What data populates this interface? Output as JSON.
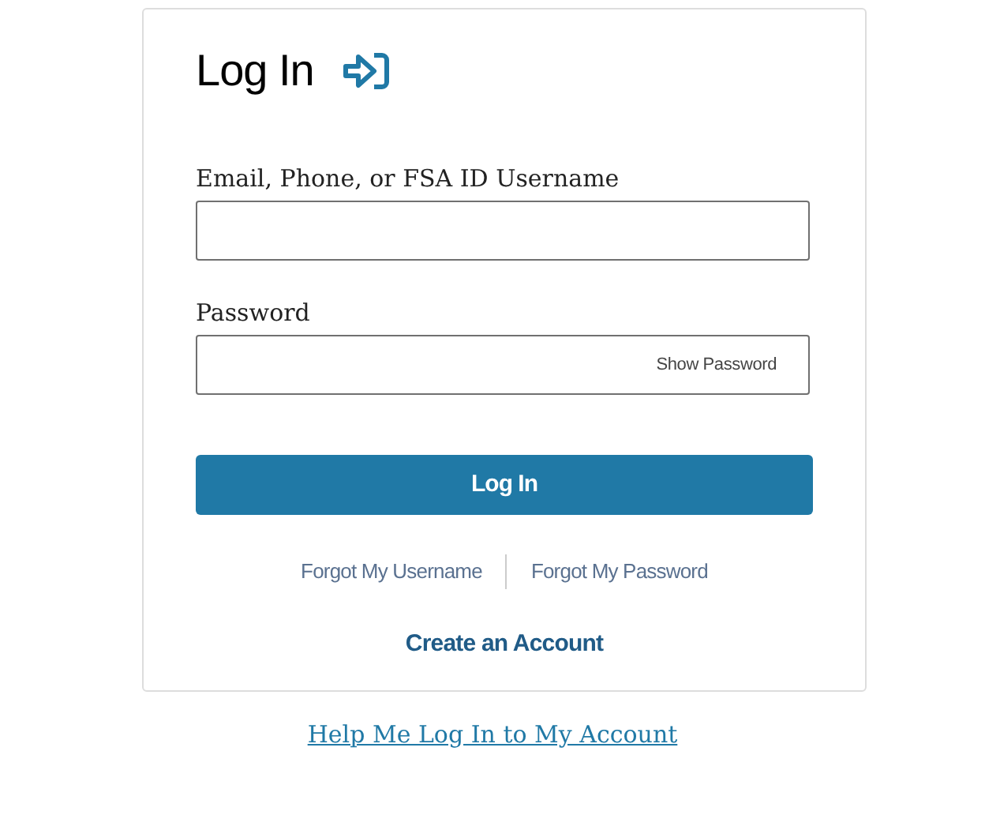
{
  "card": {
    "title": "Log In",
    "fields": [
      {
        "label": "Email, Phone, or FSA ID Username",
        "kind": "text"
      },
      {
        "label": "Password",
        "kind": "password",
        "toggle": "Show Password"
      }
    ],
    "submit": "Log In",
    "forgot_links": [
      "Forgot My Username",
      "Forgot My Password"
    ],
    "create_account": "Create an Account"
  },
  "help_link": "Help Me Log In to My Account"
}
